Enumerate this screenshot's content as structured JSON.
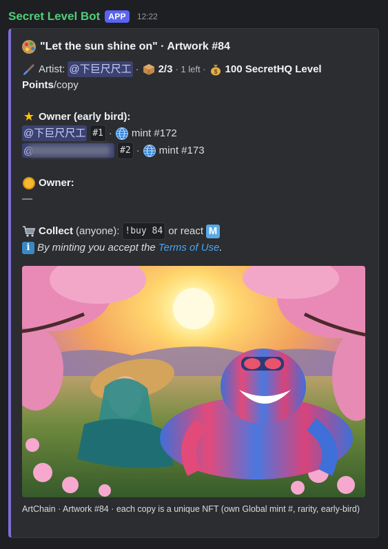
{
  "header": {
    "bot_name": "Secret Level Bot",
    "app_badge": "APP",
    "time": "12:22"
  },
  "embed": {
    "accent_color": "#7c6fd4",
    "title": "\"Let the sun shine on\" · Artwork #84",
    "artist_label": "Artist:",
    "artist_mention": "@下巨尺尺工",
    "supply": "2/3",
    "left": "· 1 left ·",
    "price_bold_1": "100 SecretHQ Level",
    "price_bold_2": "Points",
    "price_suffix": "/copy",
    "owner_early_heading": "Owner (early bird):",
    "owners": [
      {
        "mention": "@下巨尺尺工",
        "copy": "#1",
        "sep": "·",
        "mint": "mint #172"
      },
      {
        "mention": "@",
        "copy": "#2",
        "sep": "·",
        "mint": "mint #173"
      }
    ],
    "owner_heading": "Owner:",
    "owner_value": "—",
    "collect_label": "Collect",
    "collect_who": "(anyone):",
    "collect_cmd": "!buy 84",
    "collect_or": "or react",
    "react_letter": "M",
    "info_prefix": "By minting you accept the",
    "terms_link": "Terms of Use",
    "info_suffix": ".",
    "footer": "ArtChain · Artwork #84 · each copy is a unique NFT (own Global mint #, rarity, early-bird)"
  },
  "icons": {
    "title": "artist-palette-icon",
    "artist": "paintbrush-icon",
    "supply": "package-icon",
    "price": "money-bag-icon",
    "early": "star-icon",
    "mint": "globe-icon",
    "owner": "coin-icon",
    "collect": "shopping-cart-icon",
    "info": "information-icon",
    "react": "m-badge-icon"
  }
}
